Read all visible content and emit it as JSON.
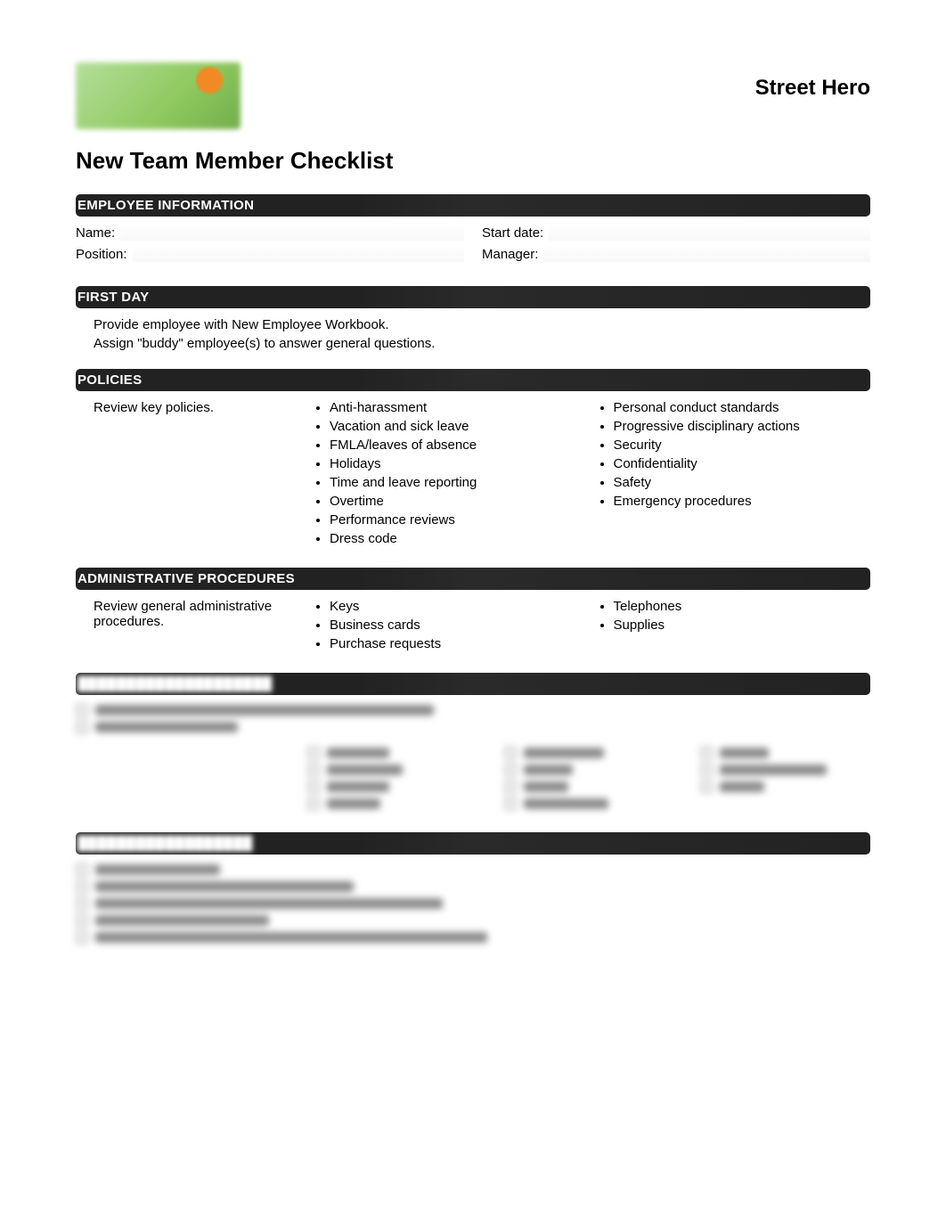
{
  "brand": "Street Hero",
  "title": "New Team Member Checklist",
  "sections": {
    "employee_info": {
      "heading": "EMPLOYEE INFORMATION",
      "name_label": "Name:",
      "position_label": "Position:",
      "start_date_label": "Start date:",
      "manager_label": "Manager:"
    },
    "first_day": {
      "heading": "FIRST DAY",
      "items": [
        "Provide employee with New Employee Workbook.",
        "Assign \"buddy\" employee(s) to answer general questions."
      ]
    },
    "policies": {
      "heading": "POLICIES",
      "lead": "Review key policies.",
      "col1": [
        "Anti-harassment",
        "Vacation and sick leave",
        "FMLA/leaves of absence",
        "Holidays",
        "Time and leave reporting",
        "Overtime",
        "Performance reviews",
        "Dress code"
      ],
      "col2": [
        "Personal conduct standards",
        "Progressive disciplinary actions",
        "Security",
        "Confidentiality",
        "Safety",
        "Emergency procedures"
      ]
    },
    "admin": {
      "heading": "ADMINISTRATIVE PROCEDURES",
      "lead": "Review general administrative procedures.",
      "col1": [
        "Keys",
        "Business cards",
        "Purchase requests"
      ],
      "col2": [
        "Telephones",
        "Supplies"
      ]
    }
  }
}
